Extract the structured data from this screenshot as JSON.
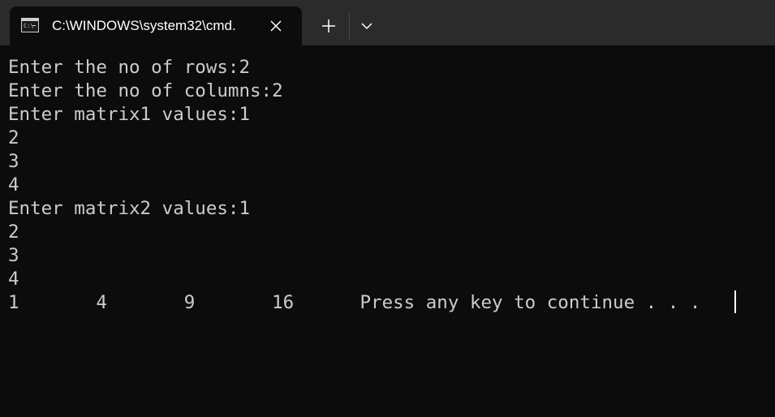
{
  "tab": {
    "icon": "cmd-icon",
    "title": "C:\\WINDOWS\\system32\\cmd."
  },
  "toolbar": {
    "close_icon": "close-icon",
    "new_tab_icon": "plus-icon",
    "dropdown_icon": "chevron-down-icon"
  },
  "console": {
    "lines": [
      "Enter the no of rows:2",
      "Enter the no of columns:2",
      "Enter matrix1 values:1",
      "2",
      "3",
      "4",
      "Enter matrix2 values:1",
      "2",
      "3",
      "4",
      "1       4       9       16      Press any key to continue . . . "
    ]
  },
  "colors": {
    "background": "#0c0c0c",
    "titlebar": "#2b2b2b",
    "text": "#cccccc"
  }
}
